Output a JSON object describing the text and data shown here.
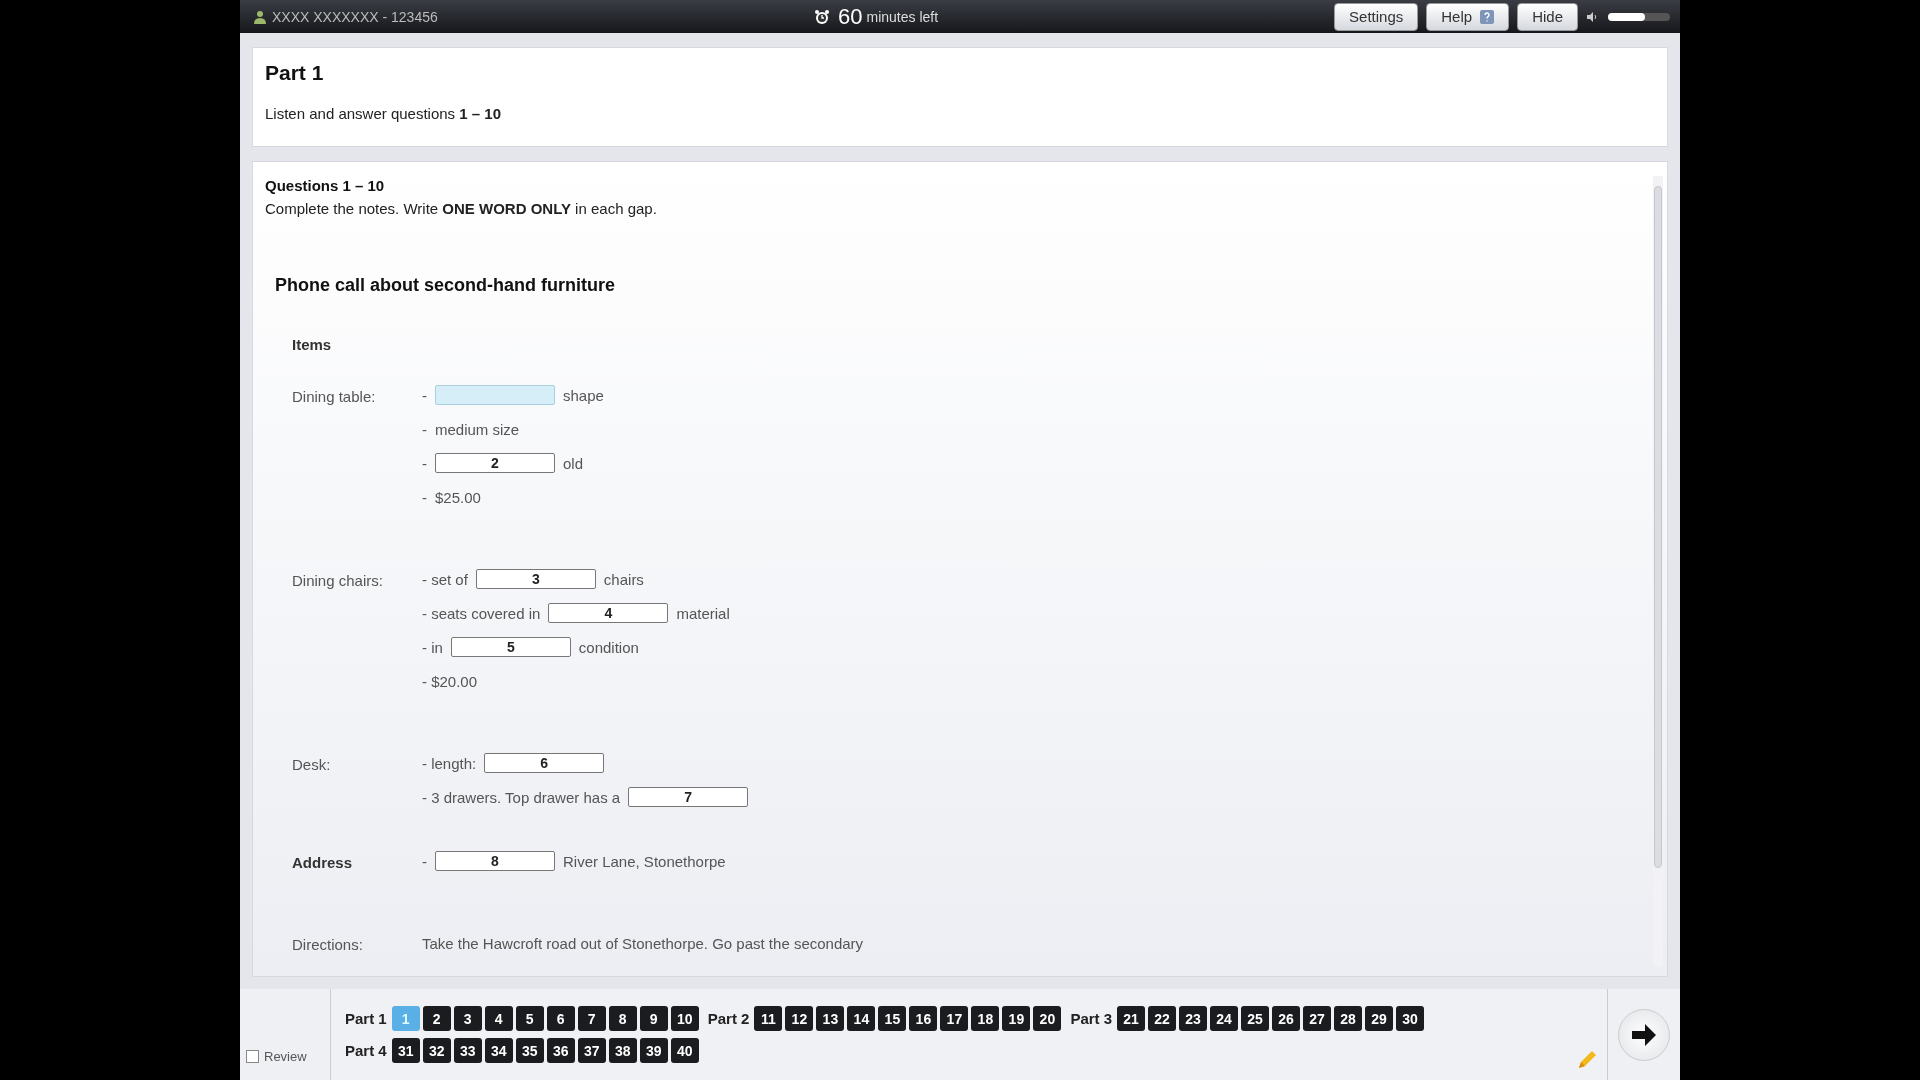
{
  "top_bar": {
    "candidate": "XXXX XXXXXXX - 123456",
    "timer_value": "60",
    "timer_label": "minutes left",
    "buttons": [
      {
        "label": "Settings",
        "kind": "plain"
      },
      {
        "label": "Help",
        "kind": "help"
      },
      {
        "label": "Hide",
        "kind": "plain"
      }
    ],
    "volume": {
      "level": 0.6
    }
  },
  "part_header": {
    "title": "Part 1",
    "instruction": "Listen and answer questions **1 – 10**"
  },
  "questions": {
    "heading": "Questions 1 – 10",
    "instruction": "Complete the notes. Write **ONE WORD ONLY** in each gap.",
    "title": "Phone call about second-hand furniture",
    "section_label": "Items",
    "groups": [
      {
        "label": "Dining table:",
        "bold": false,
        "lines": [
          {
            "parts": [
              {
                "kind": "text",
                "text": "-"
              },
              {
                "kind": "gap",
                "focused": true
              },
              {
                "kind": "text",
                "text": "shape"
              }
            ]
          },
          {
            "parts": [
              {
                "kind": "text",
                "text": "-"
              },
              {
                "kind": "text",
                "text": "medium size"
              }
            ]
          },
          {
            "parts": [
              {
                "kind": "text",
                "text": "-"
              },
              {
                "kind": "gap",
                "placeholder": "2",
                "focused": false
              },
              {
                "kind": "text",
                "text": "old"
              }
            ]
          },
          {
            "parts": [
              {
                "kind": "text",
                "text": "-"
              },
              {
                "kind": "text",
                "text": "$25.00"
              }
            ]
          }
        ]
      },
      {
        "label": "Dining chairs:",
        "bold": false,
        "lines": [
          {
            "parts": [
              {
                "kind": "text",
                "text": "- set of"
              },
              {
                "kind": "gap",
                "placeholder": "3",
                "focused": false
              },
              {
                "kind": "text",
                "text": "chairs"
              }
            ]
          },
          {
            "parts": [
              {
                "kind": "text",
                "text": "- seats covered in"
              },
              {
                "kind": "gap",
                "placeholder": "4",
                "focused": false
              },
              {
                "kind": "text",
                "text": "material"
              }
            ]
          },
          {
            "parts": [
              {
                "kind": "text",
                "text": "- in"
              },
              {
                "kind": "gap",
                "placeholder": "5",
                "focused": false
              },
              {
                "kind": "text",
                "text": "condition"
              }
            ]
          },
          {
            "parts": [
              {
                "kind": "text",
                "text": "- $20.00"
              }
            ]
          }
        ]
      },
      {
        "label": "Desk:",
        "bold": false,
        "lines": [
          {
            "parts": [
              {
                "kind": "text",
                "text": "- length:"
              },
              {
                "kind": "gap",
                "placeholder": "6",
                "focused": false
              }
            ]
          },
          {
            "parts": [
              {
                "kind": "text",
                "text": "- 3 drawers. Top drawer has a"
              },
              {
                "kind": "gap",
                "placeholder": "7",
                "focused": false
              }
            ]
          }
        ]
      },
      {
        "label": "Address",
        "bold": true,
        "lines": [
          {
            "parts": [
              {
                "kind": "text",
                "text": "-"
              },
              {
                "kind": "gap",
                "placeholder": "8",
                "focused": false
              },
              {
                "kind": "text",
                "text": "River Lane, Stonethorpe"
              }
            ]
          }
        ]
      },
      {
        "label": "Directions:",
        "bold": false,
        "lines": [
          {
            "parts": [
              {
                "kind": "text",
                "text": "Take the Hawcroft road out of Stonethorpe. Go past the secondary"
              }
            ]
          }
        ]
      }
    ]
  },
  "navigation": {
    "review": {
      "label": "Review",
      "checked": false
    },
    "rows": [
      {
        "parts": [
          {
            "label": "Part 1",
            "questions": [
              {
                "number": "1",
                "selected": true
              },
              {
                "number": "2",
                "selected": false
              },
              {
                "number": "3",
                "selected": false
              },
              {
                "number": "4",
                "selected": false
              },
              {
                "number": "5",
                "selected": false
              },
              {
                "number": "6",
                "selected": false
              },
              {
                "number": "7",
                "selected": false
              },
              {
                "number": "8",
                "selected": false
              },
              {
                "number": "9",
                "selected": false
              },
              {
                "number": "10",
                "selected": false
              }
            ]
          },
          {
            "label": "Part 2",
            "questions": [
              {
                "number": "11",
                "selected": false
              },
              {
                "number": "12",
                "selected": false
              },
              {
                "number": "13",
                "selected": false
              },
              {
                "number": "14",
                "selected": false
              },
              {
                "number": "15",
                "selected": false
              },
              {
                "number": "16",
                "selected": false
              },
              {
                "number": "17",
                "selected": false
              },
              {
                "number": "18",
                "selected": false
              },
              {
                "number": "19",
                "selected": false
              },
              {
                "number": "20",
                "selected": false
              }
            ]
          },
          {
            "label": "Part 3",
            "questions": [
              {
                "number": "21",
                "selected": false
              },
              {
                "number": "22",
                "selected": false
              },
              {
                "number": "23",
                "selected": false
              },
              {
                "number": "24",
                "selected": false
              },
              {
                "number": "25",
                "selected": false
              },
              {
                "number": "26",
                "selected": false
              },
              {
                "number": "27",
                "selected": false
              },
              {
                "number": "28",
                "selected": false
              },
              {
                "number": "29",
                "selected": false
              },
              {
                "number": "30",
                "selected": false
              }
            ]
          }
        ]
      },
      {
        "parts": [
          {
            "label": "Part 4",
            "questions": [
              {
                "number": "31",
                "selected": false
              },
              {
                "number": "32",
                "selected": false
              },
              {
                "number": "33",
                "selected": false
              },
              {
                "number": "34",
                "selected": false
              },
              {
                "number": "35",
                "selected": false
              },
              {
                "number": "36",
                "selected": false
              },
              {
                "number": "37",
                "selected": false
              },
              {
                "number": "38",
                "selected": false
              },
              {
                "number": "39",
                "selected": false
              },
              {
                "number": "40",
                "selected": false
              }
            ]
          }
        ]
      }
    ]
  }
}
